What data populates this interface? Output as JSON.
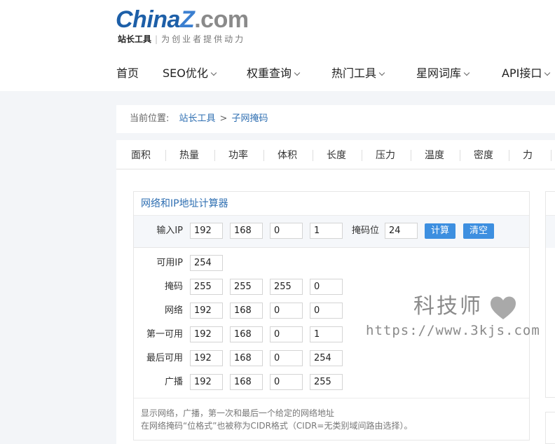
{
  "logo": {
    "part1": "China",
    "part2": "Z",
    "part3": ".com",
    "brand": "站长工具",
    "slogan": "为创业者提供动力"
  },
  "nav": [
    "首页",
    "SEO优化",
    "权重查询",
    "热门工具",
    "星网词库",
    "API接口"
  ],
  "breadcrumb": {
    "prefix": "当前位置:",
    "home": "站长工具",
    "separator": ">",
    "current": "子网掩码"
  },
  "tabs": [
    "面积",
    "热量",
    "功率",
    "体积",
    "长度",
    "压力",
    "温度",
    "密度",
    "力"
  ],
  "calculator": {
    "title": "网络和IP地址计算器",
    "input_label": "输入IP",
    "ip": [
      "192",
      "168",
      "0",
      "1"
    ],
    "mask_bits_label": "掩码位",
    "mask_bits": "24",
    "calc_button": "计算",
    "clear_button": "清空",
    "results": {
      "available_ip_label": "可用IP",
      "available_ip": "254",
      "rows": [
        {
          "label": "掩码",
          "values": [
            "255",
            "255",
            "255",
            "0"
          ]
        },
        {
          "label": "网络",
          "values": [
            "192",
            "168",
            "0",
            "0"
          ]
        },
        {
          "label": "第一可用",
          "values": [
            "192",
            "168",
            "0",
            "1"
          ]
        },
        {
          "label": "最后可用",
          "values": [
            "192",
            "168",
            "0",
            "254"
          ]
        },
        {
          "label": "广播",
          "values": [
            "192",
            "168",
            "0",
            "255"
          ]
        }
      ]
    },
    "note_line1": "显示网络，广播，第一次和最后一个给定的网络地址",
    "note_line2": "在网络掩码“位格式”也被称为CIDR格式（CIDR=无类别域间路由选择）。"
  },
  "watermark": {
    "title": "科技师",
    "url": "https://www.3kjs.com"
  },
  "colors": {
    "link": "#2f6fb2",
    "button": "#3d8fe0",
    "logo_blue": "#1d5fa8"
  }
}
